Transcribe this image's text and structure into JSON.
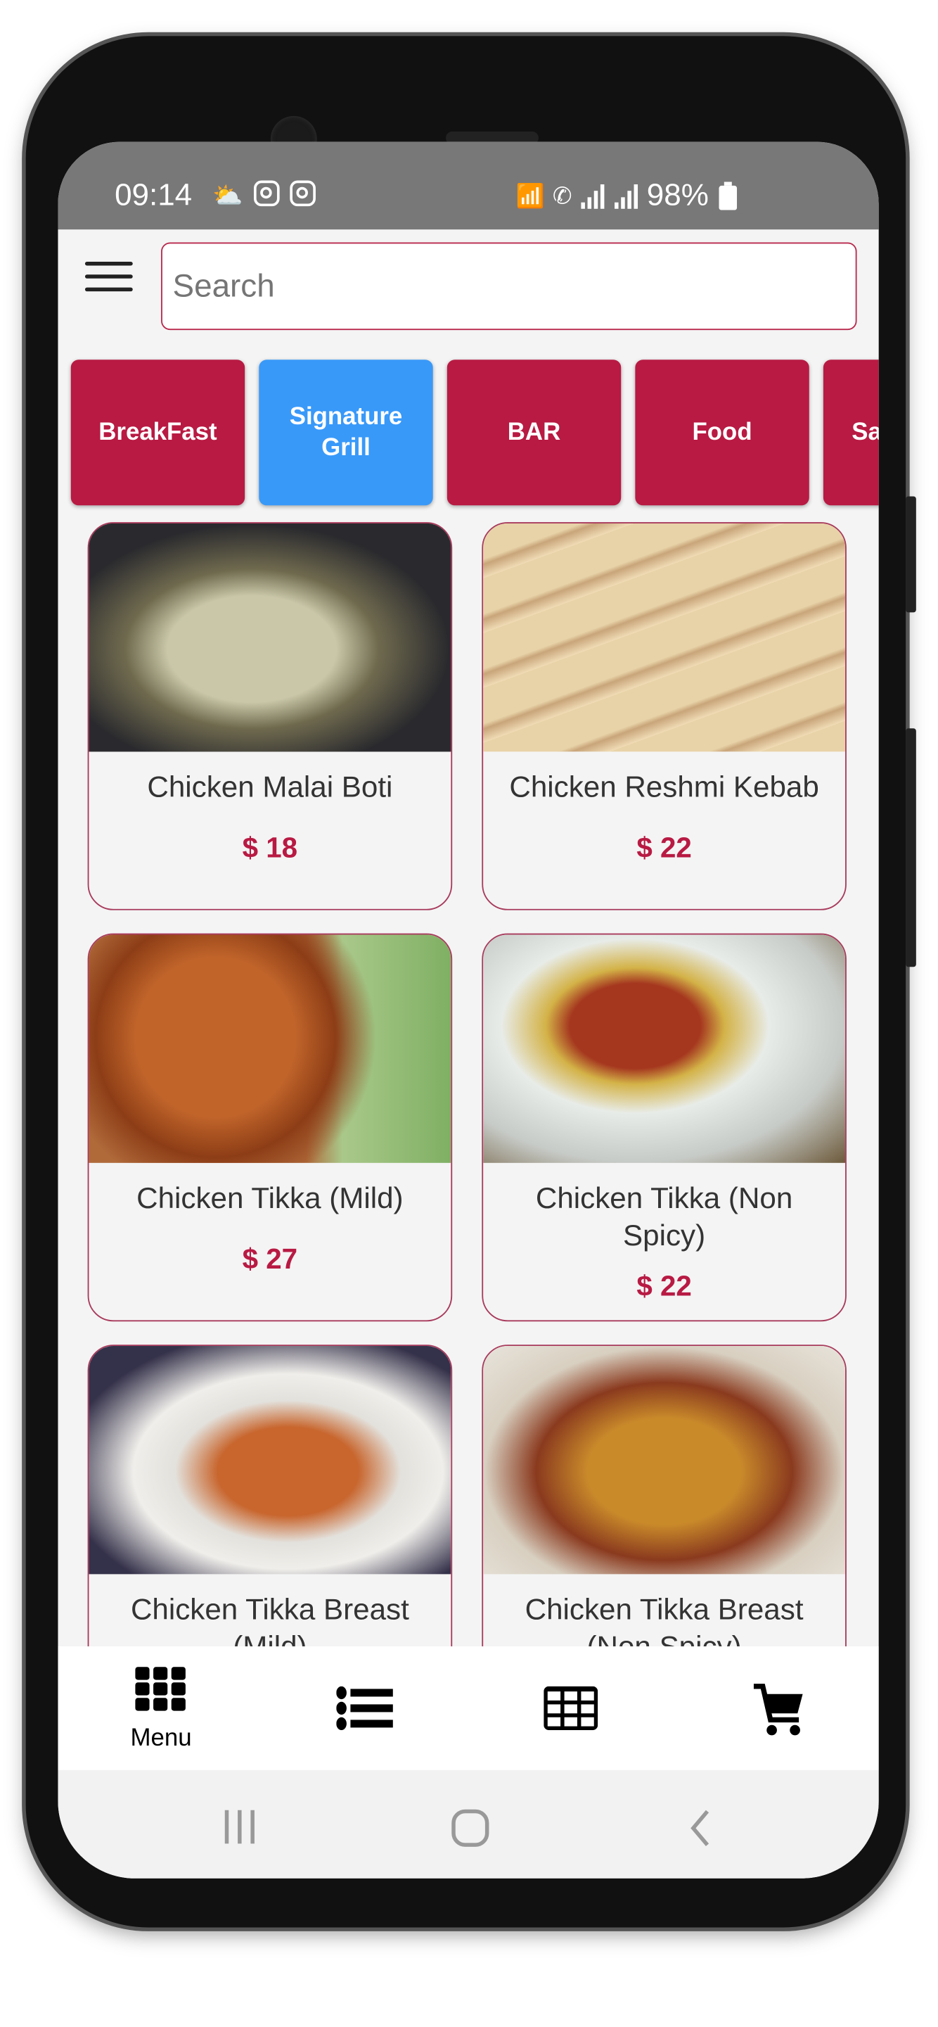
{
  "status_bar": {
    "time": "09:14",
    "battery": "98%",
    "icons": [
      "weather-sun-cloud-icon",
      "instagram-icon",
      "instagram-icon",
      "wifi-icon",
      "wifi-call-icon",
      "signal-icon",
      "roaming-signal-icon",
      "battery-icon"
    ]
  },
  "header": {
    "search_placeholder": "Search",
    "menu_icon": "hamburger-icon"
  },
  "categories": [
    {
      "label": "BreakFast",
      "active": false
    },
    {
      "label": "Signature Grill",
      "active": true
    },
    {
      "label": "BAR",
      "active": false
    },
    {
      "label": "Food",
      "active": false
    },
    {
      "label": "Sa S",
      "active": false
    }
  ],
  "products": [
    {
      "name": "Chicken Malai Boti",
      "price": "$ 18"
    },
    {
      "name": "Chicken Reshmi Kebab",
      "price": "$ 22"
    },
    {
      "name": "Chicken Tikka (Mild)",
      "price": "$ 27"
    },
    {
      "name": "Chicken Tikka (Non Spicy)",
      "price": "$ 22"
    },
    {
      "name": "Chicken Tikka Breast (Mild)",
      "price": ""
    },
    {
      "name": "Chicken Tikka Breast (Non Spicy)",
      "price": ""
    }
  ],
  "bottom_nav": [
    {
      "icon": "grid-menu-icon",
      "label": "Menu"
    },
    {
      "icon": "list-icon",
      "label": ""
    },
    {
      "icon": "table-icon",
      "label": ""
    },
    {
      "icon": "cart-icon",
      "label": ""
    }
  ],
  "colors": {
    "primary": "#b81a43",
    "active": "#3899f9",
    "status_bar": "#787878"
  }
}
